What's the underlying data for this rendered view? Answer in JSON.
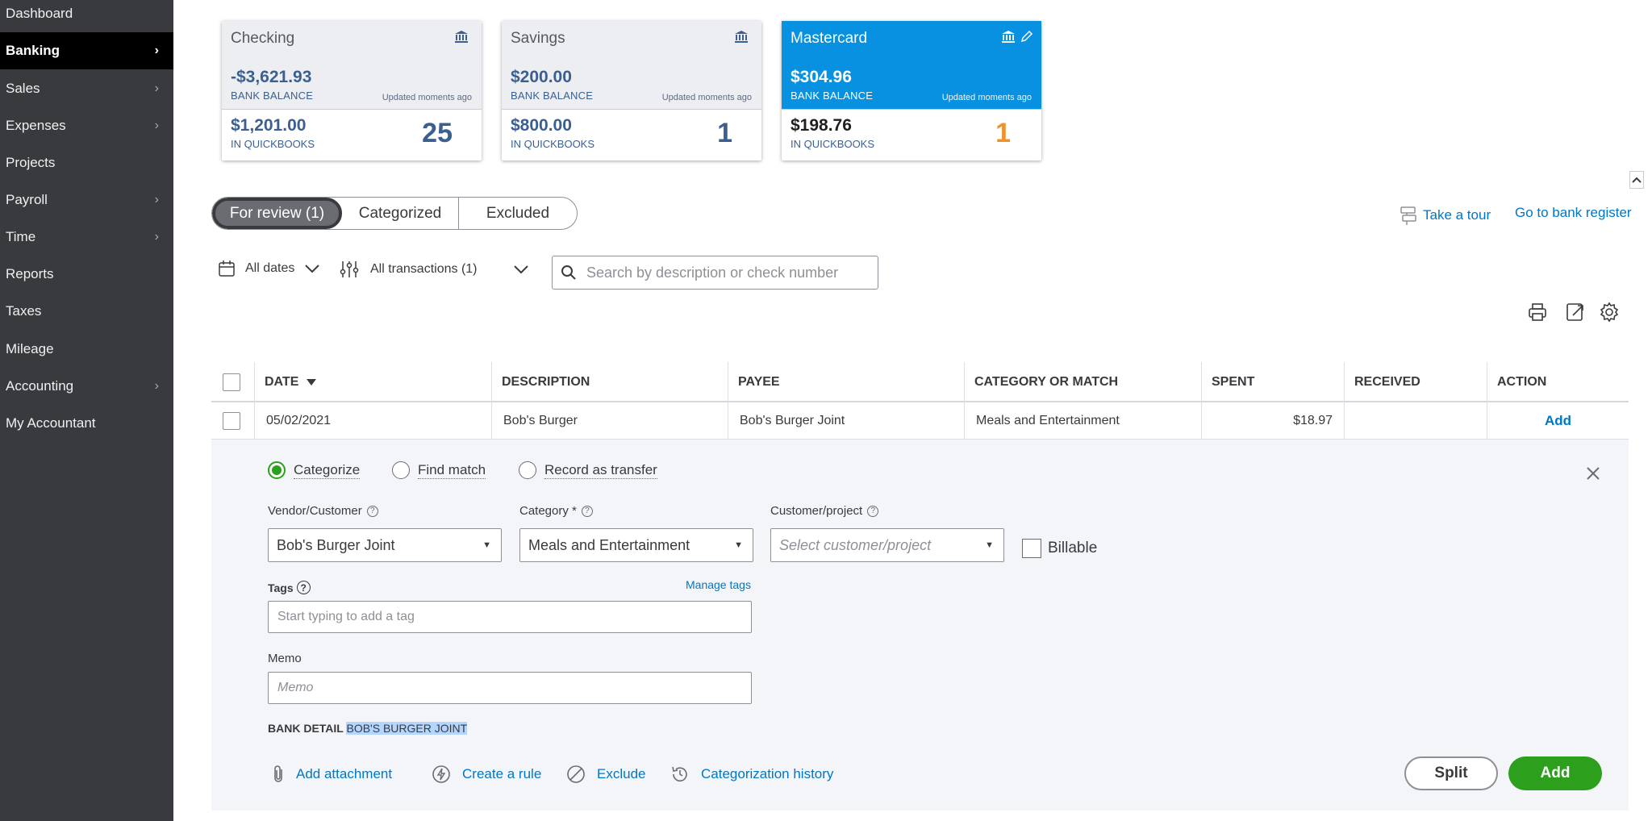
{
  "sidebar": {
    "items": [
      {
        "label": "Dashboard",
        "has_chevron": false
      },
      {
        "label": "Banking",
        "has_chevron": true,
        "active": true
      },
      {
        "label": "Sales",
        "has_chevron": true
      },
      {
        "label": "Expenses",
        "has_chevron": true
      },
      {
        "label": "Projects",
        "has_chevron": false
      },
      {
        "label": "Payroll",
        "has_chevron": true
      },
      {
        "label": "Time",
        "has_chevron": true
      },
      {
        "label": "Reports",
        "has_chevron": false
      },
      {
        "label": "Taxes",
        "has_chevron": false
      },
      {
        "label": "Mileage",
        "has_chevron": false
      },
      {
        "label": "Accounting",
        "has_chevron": true
      },
      {
        "label": "My Accountant",
        "has_chevron": false
      }
    ],
    "chevron": "›"
  },
  "accounts": [
    {
      "name": "Checking",
      "bank_balance": "-$3,621.93",
      "bank_balance_label": "BANK BALANCE",
      "updated": "Updated moments ago",
      "qb_balance": "$1,201.00",
      "qb_label": "IN QUICKBOOKS",
      "count": "25",
      "selected": false
    },
    {
      "name": "Savings",
      "bank_balance": "$200.00",
      "bank_balance_label": "BANK BALANCE",
      "updated": "Updated moments ago",
      "qb_balance": "$800.00",
      "qb_label": "IN QUICKBOOKS",
      "count": "1",
      "selected": false
    },
    {
      "name": "Mastercard",
      "bank_balance": "$304.96",
      "bank_balance_label": "BANK BALANCE",
      "updated": "Updated moments ago",
      "qb_balance": "$198.76",
      "qb_label": "IN QUICKBOOKS",
      "count": "1",
      "selected": true
    }
  ],
  "tabs": [
    {
      "label": "For review (1)",
      "active": true
    },
    {
      "label": "Categorized",
      "active": false
    },
    {
      "label": "Excluded",
      "active": false
    }
  ],
  "links": {
    "take_tour": "Take a tour",
    "bank_register": "Go to bank register"
  },
  "filters": {
    "dates": "All dates",
    "transactions": "All transactions (1)",
    "search_placeholder": "Search by description or check number"
  },
  "table": {
    "headers": {
      "date": "DATE",
      "description": "DESCRIPTION",
      "payee": "PAYEE",
      "category": "CATEGORY OR MATCH",
      "spent": "SPENT",
      "received": "RECEIVED",
      "action": "ACTION"
    },
    "row": {
      "date": "05/02/2021",
      "description": "Bob's Burger",
      "payee": "Bob's Burger Joint",
      "category": "Meals and Entertainment",
      "spent": "$18.97",
      "received": "",
      "action": "Add"
    }
  },
  "detail": {
    "radios": [
      {
        "label": "Categorize",
        "checked": true
      },
      {
        "label": "Find match",
        "checked": false
      },
      {
        "label": "Record as transfer",
        "checked": false
      }
    ],
    "vendor_label": "Vendor/Customer",
    "vendor_value": "Bob's Burger Joint",
    "category_label": "Category *",
    "category_value": "Meals and Entertainment",
    "customer_label": "Customer/project",
    "customer_placeholder": "Select customer/project",
    "billable_label": "Billable",
    "tags_label": "Tags",
    "manage_tags": "Manage tags",
    "tags_placeholder": "Start typing to add a tag",
    "memo_label": "Memo",
    "memo_placeholder": "Memo",
    "bank_detail_label": "BANK DETAIL",
    "bank_detail_value": "BOB'S BURGER JOINT",
    "actions": {
      "attachment": "Add attachment",
      "rule": "Create a rule",
      "exclude": "Exclude",
      "history": "Categorization history"
    },
    "split_button": "Split",
    "add_button": "Add"
  },
  "colors": {
    "sidebar_bg": "#393a3d",
    "selected_card": "#0891e0",
    "link": "#0077c5",
    "primary_green": "#2ca01c",
    "count_orange": "#f0922b"
  }
}
